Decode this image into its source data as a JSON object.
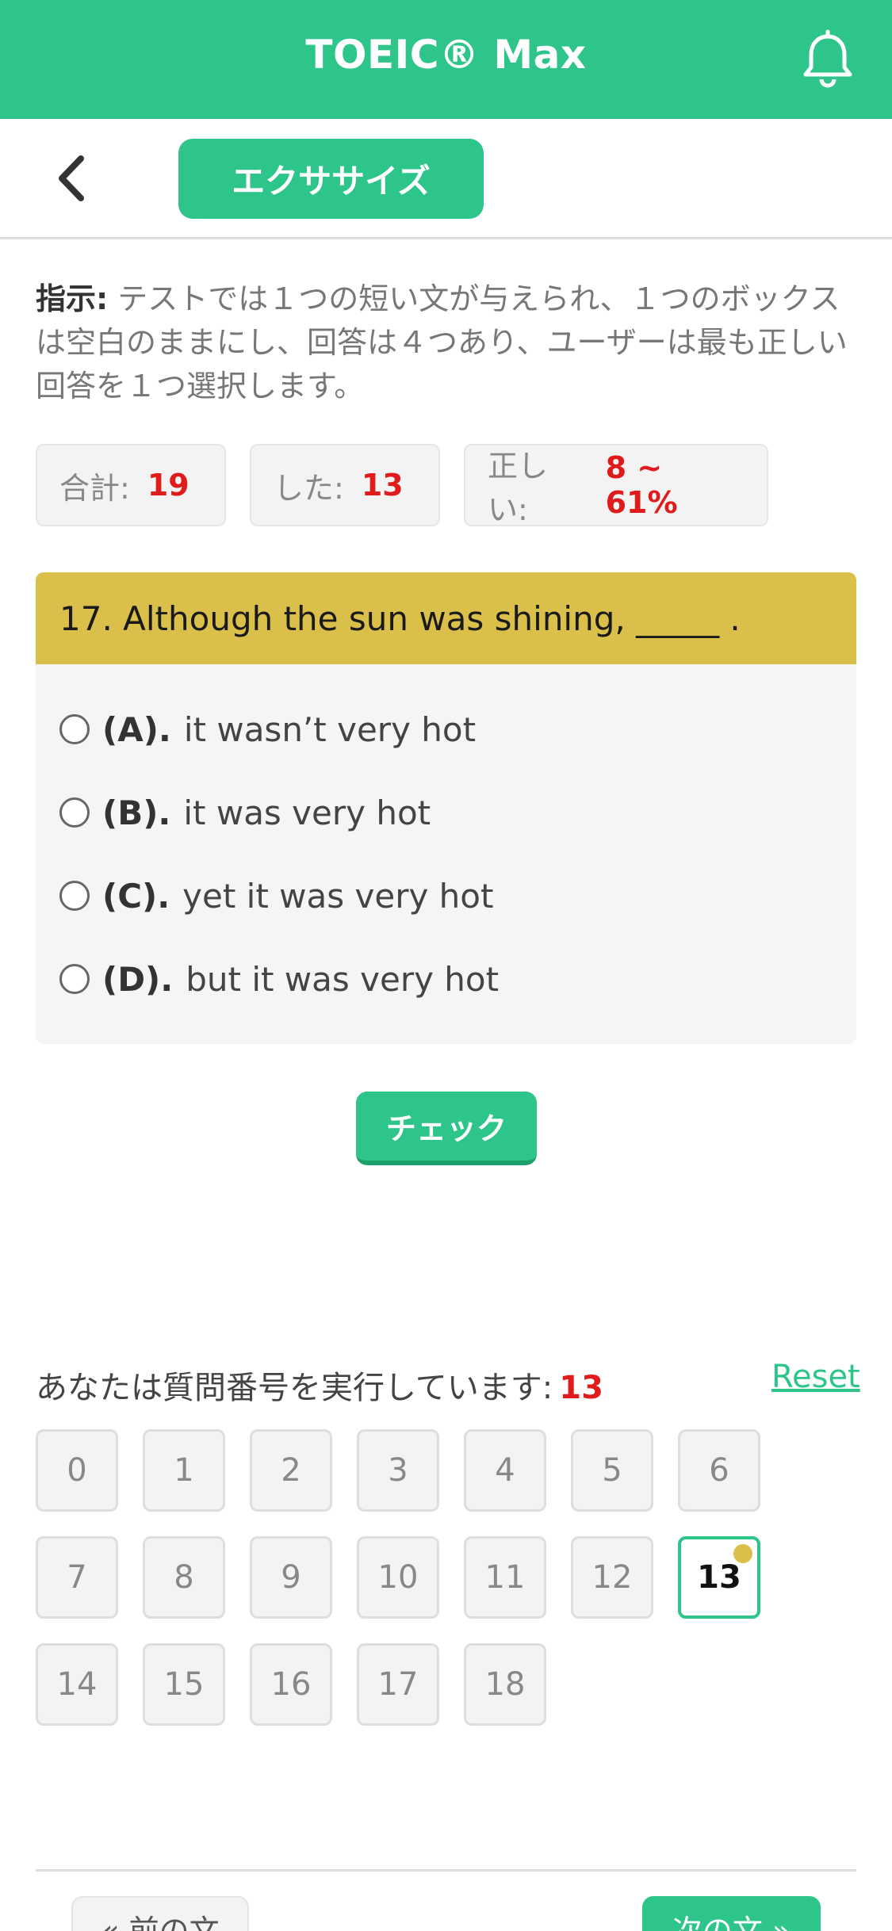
{
  "header": {
    "title": "TOEIC® Max",
    "bell_icon": "bell-icon"
  },
  "subnav": {
    "back_icon": "chevron-left-icon",
    "exercise_label": "エクササイズ"
  },
  "instruction": {
    "label": "指示:",
    "text": " テストでは１つの短い文が与えられ、１つのボックスは空白のままにし、回答は４つあり、ユーザーは最も正しい回答を１つ選択します。"
  },
  "stats": {
    "total_label": "合計:",
    "total_value": "19",
    "done_label": "した:",
    "done_value": "13",
    "correct_label": "正しい:",
    "correct_value": "8 ~ 61%"
  },
  "question": {
    "text": "17. Although the sun was shining, _____ .",
    "options": [
      {
        "label": "(A).",
        "text": "it wasn’t very hot"
      },
      {
        "label": "(B).",
        "text": "it was very hot"
      },
      {
        "label": "(C).",
        "text": "yet it was very hot"
      },
      {
        "label": "(D).",
        "text": "but it was very hot"
      }
    ]
  },
  "check_label": "チェック",
  "progress": {
    "label": "あなたは質問番号を実行しています:",
    "current": "13",
    "reset_label": "Reset"
  },
  "numbers": [
    "0",
    "1",
    "2",
    "3",
    "4",
    "5",
    "6",
    "7",
    "8",
    "9",
    "10",
    "11",
    "12",
    "13",
    "14",
    "15",
    "16",
    "17",
    "18"
  ],
  "active_number": "13",
  "nav": {
    "prev_label": "« 前の文",
    "next_label": "次の文 »"
  },
  "colors": {
    "accent": "#2ec58b",
    "question_bar": "#dbbf4b",
    "highlight": "#e01b1b"
  }
}
